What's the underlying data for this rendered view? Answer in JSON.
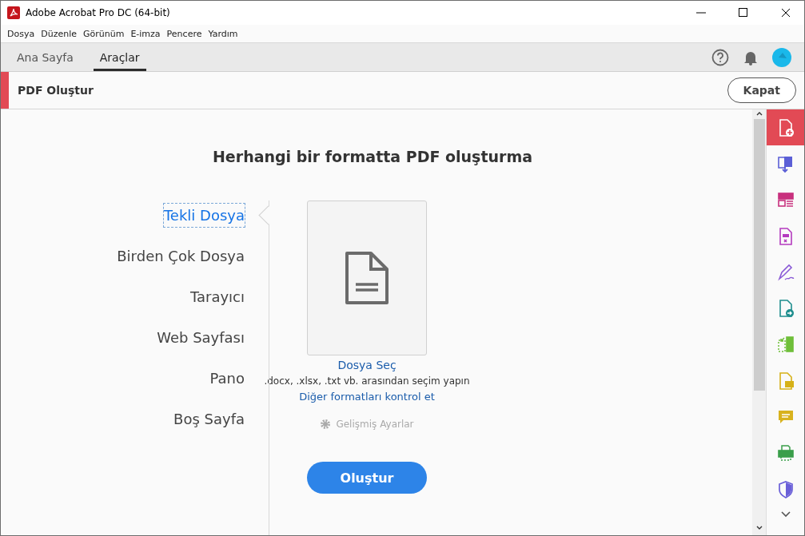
{
  "window": {
    "title": "Adobe Acrobat Pro DC (64-bit)"
  },
  "menu": [
    "Dosya",
    "Düzenle",
    "Görünüm",
    "E-imza",
    "Pencere",
    "Yardım"
  ],
  "tabs": [
    {
      "label": "Ana Sayfa",
      "selected": false
    },
    {
      "label": "Araçlar",
      "selected": true
    }
  ],
  "tool_header": {
    "title": "PDF Oluştur",
    "close_button": "Kapat"
  },
  "heading": "Herhangi bir formatta PDF oluşturma",
  "sources": [
    {
      "label": "Tekli Dosya",
      "selected": true
    },
    {
      "label": "Birden Çok Dosya",
      "selected": false
    },
    {
      "label": "Tarayıcı",
      "selected": false
    },
    {
      "label": "Web Sayfası",
      "selected": false
    },
    {
      "label": "Pano",
      "selected": false
    },
    {
      "label": "Boş Sayfa",
      "selected": false
    }
  ],
  "file_picker": {
    "link": "Dosya Seç",
    "hint": ".docx, .xlsx, .txt vb. arasından seçim yapın",
    "formats_link": "Diğer formatları kontrol et",
    "advanced": "Gelişmiş Ayarlar",
    "disabled_advanced": true,
    "create_button": "Oluştur"
  },
  "tools": [
    {
      "color": "#ffffff",
      "selected": true
    },
    {
      "color": "#5b5fd6",
      "selected": false
    },
    {
      "color": "#c8307e",
      "selected": false
    },
    {
      "color": "#b43bbf",
      "selected": false
    },
    {
      "color": "#8a5ad6",
      "selected": false
    },
    {
      "color": "#1f8e8e",
      "selected": false
    },
    {
      "color": "#6fbf3a",
      "selected": false
    },
    {
      "color": "#d6b118",
      "selected": false
    },
    {
      "color": "#d8b21e",
      "selected": false
    },
    {
      "color": "#3a9e4a",
      "selected": false
    },
    {
      "color": "#6a5fd8",
      "selected": false
    }
  ]
}
